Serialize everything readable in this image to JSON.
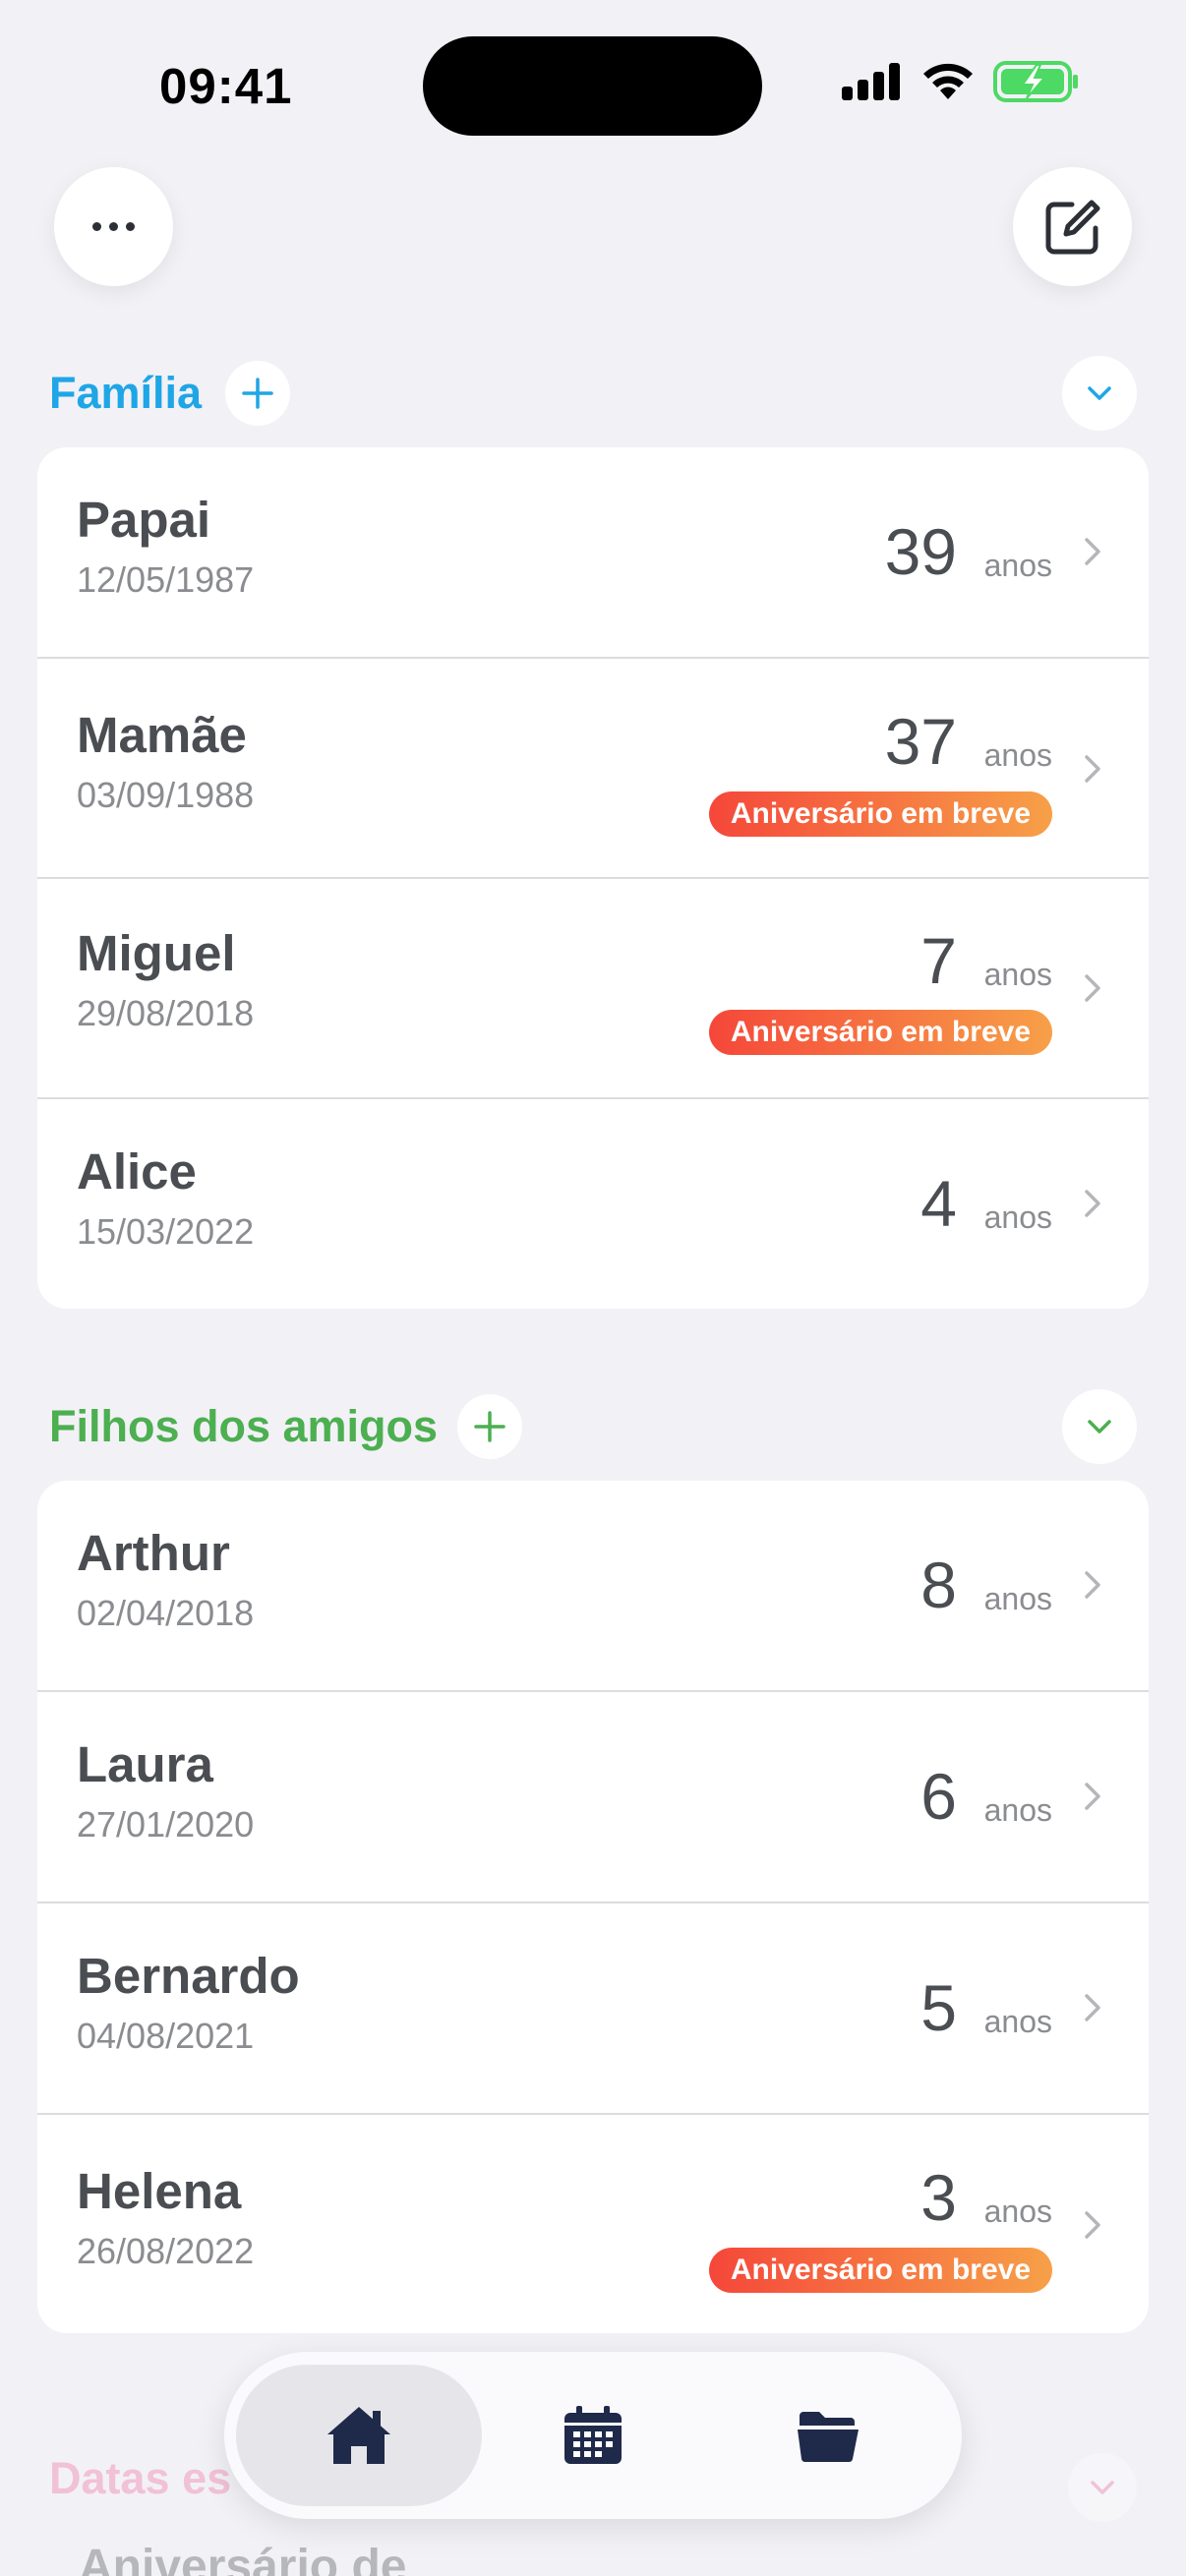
{
  "status_bar": {
    "time": "09:41"
  },
  "colors": {
    "familia": "#1ea6e6",
    "amigos": "#4caf50",
    "datas": "#f06aa0",
    "badge_start": "#f5473a",
    "badge_end": "#f7a048"
  },
  "header": {
    "more_icon": "ellipsis-icon",
    "compose_icon": "compose-icon"
  },
  "sections": [
    {
      "title": "Família",
      "rows": [
        {
          "name": "Papai",
          "date": "12/05/1987",
          "age": "39",
          "unit": "anos"
        },
        {
          "name": "Mamãe",
          "date": "03/09/1988",
          "age": "37",
          "unit": "anos",
          "badge": "Aniversário em breve"
        },
        {
          "name": "Miguel",
          "date": "29/08/2018",
          "age": "7",
          "unit": "anos",
          "badge": "Aniversário em breve"
        },
        {
          "name": "Alice",
          "date": "15/03/2022",
          "age": "4",
          "unit": "anos"
        }
      ]
    },
    {
      "title": "Filhos dos amigos",
      "rows": [
        {
          "name": "Arthur",
          "date": "02/04/2018",
          "age": "8",
          "unit": "anos"
        },
        {
          "name": "Laura",
          "date": "27/01/2020",
          "age": "6",
          "unit": "anos"
        },
        {
          "name": "Bernardo",
          "date": "04/08/2021",
          "age": "5",
          "unit": "anos"
        },
        {
          "name": "Helena",
          "date": "26/08/2022",
          "age": "3",
          "unit": "anos",
          "badge": "Aniversário em breve"
        }
      ]
    },
    {
      "title": "Datas es",
      "rows": [
        {
          "name": "Aniversário de"
        }
      ]
    }
  ],
  "tabbar": {
    "tabs": [
      {
        "icon": "house-icon",
        "active": true
      },
      {
        "icon": "calendar-icon",
        "active": false
      },
      {
        "icon": "folder-icon",
        "active": false
      }
    ]
  }
}
